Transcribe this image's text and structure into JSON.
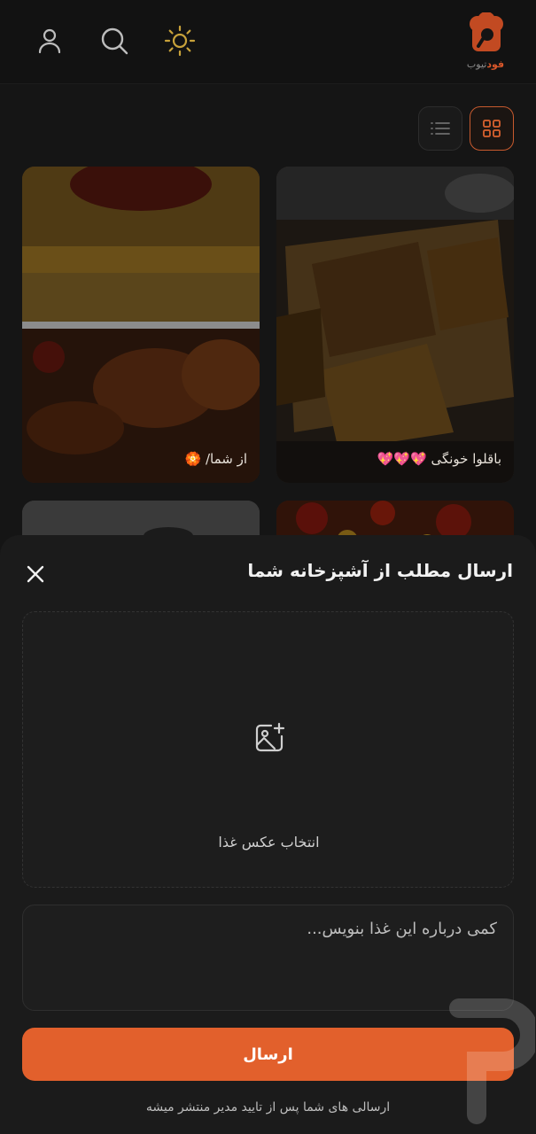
{
  "app": {
    "logo_text_accent": "فود",
    "logo_text_muted": "تیوب",
    "brand_color": "#e2602c"
  },
  "header": {
    "icons": [
      "profile-icon",
      "search-icon",
      "theme-sun-icon"
    ]
  },
  "view_toggle": {
    "active": "grid",
    "options": [
      "grid-view-icon",
      "list-view-icon"
    ]
  },
  "cards": [
    {
      "caption": "باقلوا خونگی 💖💖💖"
    },
    {
      "caption": "از شما/ 🏵️"
    },
    {
      "caption": ""
    },
    {
      "caption": ""
    }
  ],
  "sheet": {
    "title": "ارسال مطلب از آشپزخانه شما",
    "upload_label": "انتخاب عکس غذا",
    "description_placeholder": "کمی درباره این غذا بنویس...",
    "submit_label": "ارسال",
    "note": "ارسالی های شما پس از تایید مدیر منتشر میشه"
  }
}
